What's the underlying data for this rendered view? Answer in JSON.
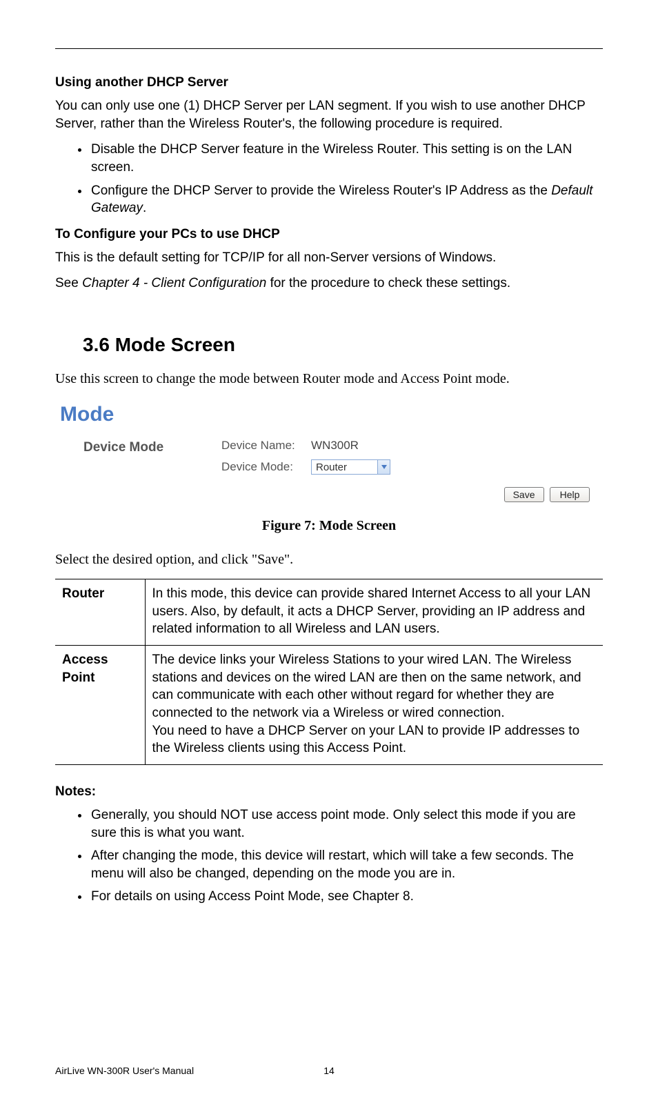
{
  "header": {
    "h1": "Using another DHCP Server",
    "p1": "You can only use one (1) DHCP Server per LAN segment. If you wish to use another DHCP Server, rather than the Wireless Router's, the following procedure is required.",
    "bullets1": [
      "Disable the DHCP Server feature in the Wireless Router. This setting is on the LAN screen.",
      "Configure the DHCP Server to provide the Wireless Router's IP Address as the "
    ],
    "bullets1_italic_suffix": "Default Gateway",
    "h2": "To Configure your PCs to use DHCP",
    "p2": "This is the default setting for TCP/IP for all non-Server versions of Windows.",
    "p3_pre": "See ",
    "p3_italic": "Chapter 4 - Client Configuration",
    "p3_post": " for the procedure to check these settings."
  },
  "section": {
    "number_title": "3.6  Mode Screen",
    "intro": "Use this screen to change the mode between Router mode and Access Point mode."
  },
  "mode_screen": {
    "title": "Mode",
    "row_label": "Device Mode",
    "device_name_label": "Device Name:",
    "device_name_value": "WN300R",
    "device_mode_label": "Device Mode:",
    "dropdown_value": "Router",
    "save_btn": "Save",
    "help_btn": "Help"
  },
  "figure_caption": "Figure 7: Mode Screen",
  "after_figure": "Select the desired option, and click \"Save\".",
  "table": {
    "rows": [
      {
        "key": "Router",
        "val": "In this mode, this device can provide shared Internet Access to all your LAN users. Also, by default, it acts a DHCP Server, providing an IP address and related information to all Wireless and LAN users."
      },
      {
        "key": "Access Point",
        "val": "The device links your Wireless Stations to your wired LAN. The Wireless stations and devices on the wired LAN are then on the same network, and can communicate with each other without regard for whether they are connected to the network via a Wireless or wired connection.\nYou need to have a DHCP Server on your LAN to provide IP addresses to the Wireless clients using this Access Point."
      }
    ]
  },
  "notes": {
    "heading": "Notes:",
    "items": [
      "Generally, you should NOT use access point mode. Only select this mode if you are sure this is what you want.",
      "After changing the mode, this device will restart, which will take a few seconds. The menu will also be changed, depending on the mode you are in.",
      "For details on using Access Point Mode, see Chapter 8."
    ]
  },
  "footer": {
    "manual": "AirLive WN-300R User's Manual",
    "page": "14"
  }
}
